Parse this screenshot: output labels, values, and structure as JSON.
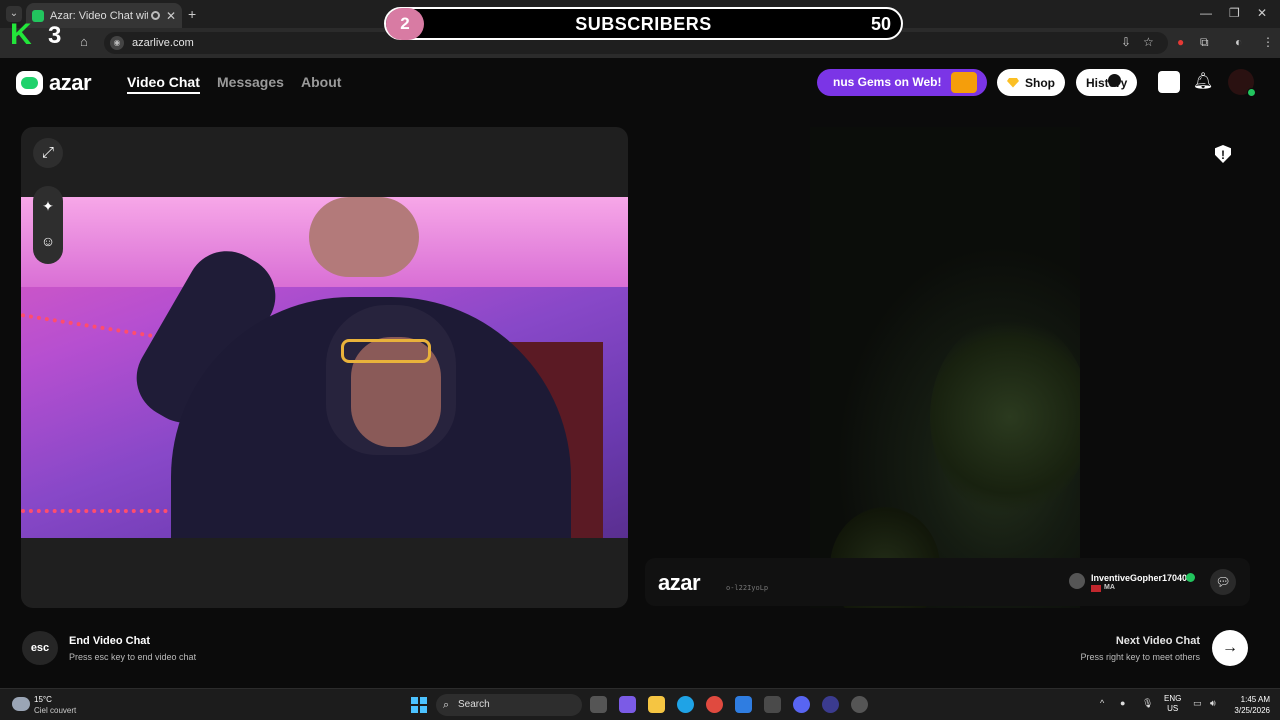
{
  "browser": {
    "tab_title": "Azar: Video Chat with New",
    "url": "azarlive.com"
  },
  "overlay": {
    "k_letter": "K",
    "k_number": "3",
    "subs_current": "2",
    "subs_label": "SUBSCRIBERS",
    "subs_goal": "50"
  },
  "header": {
    "logo_text": "azar",
    "nav": [
      {
        "label": "Video Chat"
      },
      {
        "label": "Messages"
      },
      {
        "label": "About"
      }
    ],
    "promo_text": "nus Gems on Web!",
    "shop_label": "Shop",
    "history_label": "History"
  },
  "remote": {
    "watermark_logo": "azar",
    "watermark_id": "o-l22IyoLp",
    "username": "InventiveGopher17040",
    "country": "MA"
  },
  "controls": {
    "esc_label": "esc",
    "end_title": "End Video Chat",
    "end_sub": "Press esc key to end video chat",
    "next_title": "Next Video Chat",
    "next_sub": "Press right key to meet others"
  },
  "taskbar": {
    "temp": "15°C",
    "weather": "Ciel couvert",
    "search_label": "Search",
    "lang_line1": "ENG",
    "lang_line2": "US",
    "time": "1:45 AM",
    "date": "3/25/2026"
  },
  "colors": {
    "accent_green": "#1fd26b",
    "promo_purple": "#7b35e6",
    "k_green": "#22e63a"
  }
}
